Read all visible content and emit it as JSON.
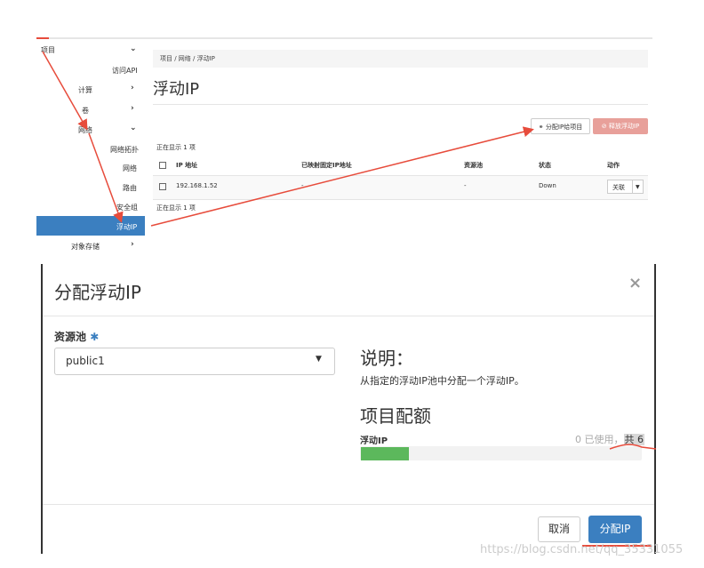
{
  "sidebar": {
    "items": [
      {
        "label": "项目",
        "chevron": "chevron-down"
      },
      {
        "label": "访问API"
      },
      {
        "label": "计算",
        "chevron": "chevron-right"
      },
      {
        "label": "卷",
        "chevron": "chevron-right"
      },
      {
        "label": "网络",
        "chevron": "chevron-down"
      },
      {
        "label": "网络拓扑"
      },
      {
        "label": "网络"
      },
      {
        "label": "路由"
      },
      {
        "label": "安全组"
      },
      {
        "label": "浮动IP",
        "active": true
      },
      {
        "label": "对象存储",
        "chevron": "chevron-right"
      }
    ]
  },
  "breadcrumb": "项目 / 网络 / 浮动IP",
  "page_title": "浮动IP",
  "actions": {
    "allocate": "分配IP给项目",
    "release": "释放浮动IP"
  },
  "table": {
    "count_top": "正在显示 1 项",
    "count_bottom": "正在显示 1 项",
    "headers": [
      "IP 地址",
      "已映射固定IP地址",
      "资源池",
      "状态",
      "动作"
    ],
    "rows": [
      {
        "ip": "192.168.1.52",
        "fixed": "-",
        "pool": "-",
        "status": "Down",
        "action": "关联"
      }
    ]
  },
  "modal": {
    "title": "分配浮动IP",
    "pool_label": "资源池",
    "required_mark": "✱",
    "pool_value": "public1",
    "desc_heading": "说明：",
    "desc_text": "从指定的浮动IP池中分配一个浮动IP。",
    "quota_heading": "项目配额",
    "quota_label": "浮动IP",
    "usage_used": "0 已使用，",
    "usage_total": "共 6",
    "usage_fraction": 0.17,
    "cancel": "取消",
    "submit": "分配IP"
  },
  "watermark": "https://blog.csdn.net/qq_35331055",
  "colors": {
    "primary": "#3b7fc0",
    "danger": "#e8a09a",
    "progress": "#5cb85c",
    "annotation": "#e74c3c"
  }
}
